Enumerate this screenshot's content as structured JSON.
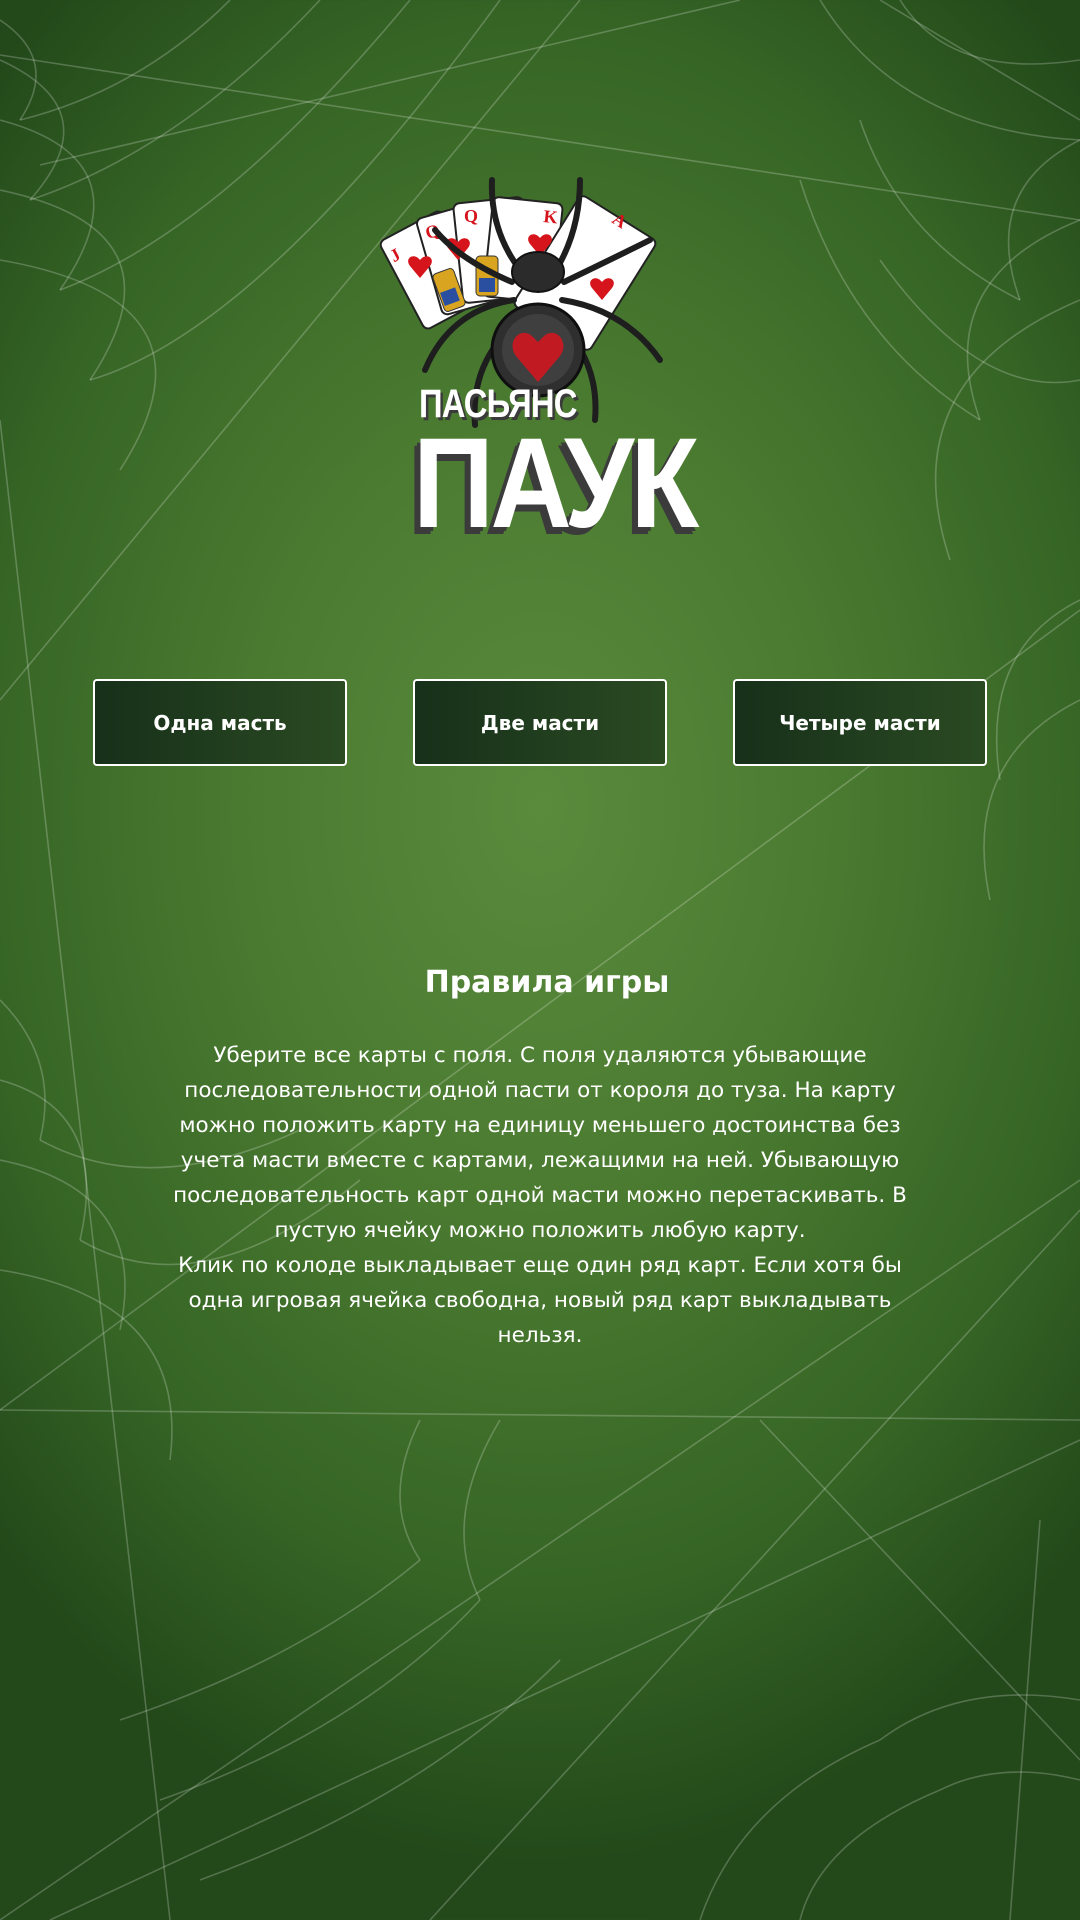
{
  "logo": {
    "line1": "ПАСЬЯНС",
    "line2": "ПАУК",
    "card_letters": [
      "J",
      "Q",
      "Q",
      "K",
      "A"
    ]
  },
  "modes": [
    {
      "label": "Одна масть"
    },
    {
      "label": "Две масти"
    },
    {
      "label": "Четыре масти"
    }
  ],
  "rules": {
    "title": "Правила игры",
    "paragraph1": "Уберите все карты с поля. С поля удаляются убывающие последовательности одной пасти от короля до туза. На карту можно положить карту на единицу меньшего достоинства без учета масти вместе с картами, лежащими на ней. Убывающую последовательность карт одной масти можно перетаскивать. В пустую ячейку можно положить любую карту.",
    "paragraph2": "Клик по колоде выкладывает еще один ряд карт. Если хотя бы одна игровая ячейка свободна, новый ряд карт выкладывать нельзя."
  },
  "colors": {
    "background_center": "#5a8a3c",
    "background_edge": "#23491a",
    "button_fill": "#1f3b1d",
    "button_border": "#ffffff",
    "card_suit": "#d6141c",
    "spider_body": "#2b2b2b"
  }
}
